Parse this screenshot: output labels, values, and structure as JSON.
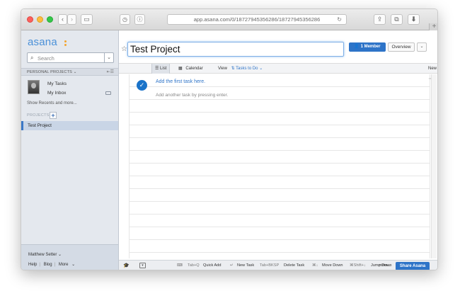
{
  "browser": {
    "url": "app.asana.com/0/18727945356286/18727945356286"
  },
  "sidebar": {
    "logo": "asana",
    "search_placeholder": "Search",
    "section_header": "PERSONAL PROJECTS",
    "my_tasks": "My Tasks",
    "my_inbox": "My Inbox",
    "show_recents": "Show Recents and more...",
    "projects_label": "PROJECTS",
    "project_name": "Test Project",
    "user_name": "Matthew Setter",
    "footer_links": [
      "Help",
      "Blog",
      "More"
    ]
  },
  "main": {
    "title": "Test Project",
    "member_button": "1 Member",
    "overview_button": "Overview",
    "tabs": {
      "list": "List",
      "calendar": "Calendar",
      "view_label": "View",
      "view_value": "Tasks to Do",
      "new": "New"
    },
    "first_task": "Add the first task here.",
    "next_task": "Add another task by pressing enter."
  },
  "shortcuts": {
    "quick_add_key": "Tab+Q",
    "quick_add": "Quick Add",
    "new_task": "New Task",
    "delete_key": "Tab+BKSP",
    "delete_task": "Delete Task",
    "move_down": "Move Down",
    "jump_key": "⌘Shift+↓",
    "jump_down": "Jump Down",
    "more": "more...",
    "share": "Share Asana"
  },
  "colors": {
    "accent": "#2e74c8",
    "sidebar_bg": "#e4e8ee",
    "logo_dots": "#f3a42e"
  }
}
